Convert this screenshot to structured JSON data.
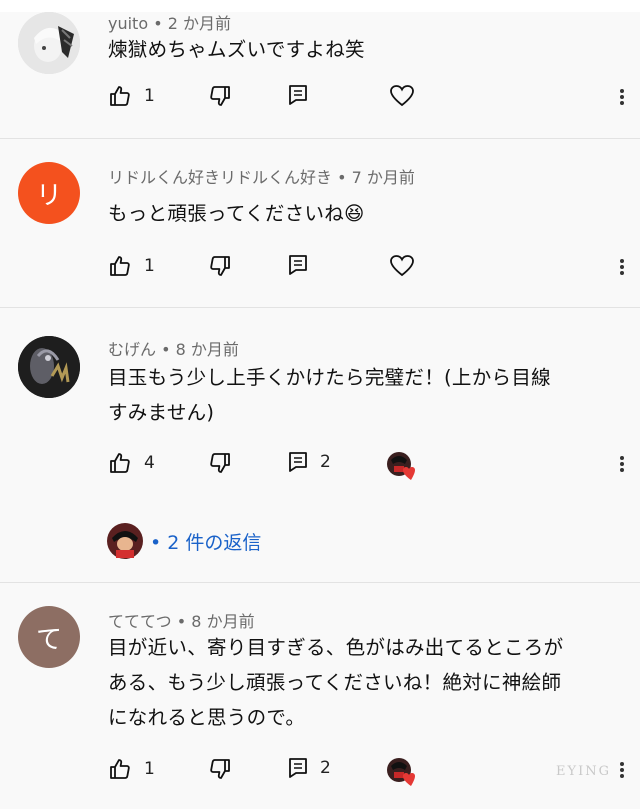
{
  "comments": [
    {
      "author": "yuito",
      "time": "2 か月前",
      "text": "煉獄めちゃムズいですよね笑",
      "likes": "1",
      "replies_count": "",
      "avatar_letter": "",
      "avatar_color": "#d8d8d8"
    },
    {
      "author": "リドルくん好きリドルくん好き",
      "time": "7 か月前",
      "text": "もっと頑張ってくださいね😆",
      "likes": "1",
      "replies_count": "",
      "avatar_letter": "リ",
      "avatar_color": "#f4511e"
    },
    {
      "author": "むげん",
      "time": "8 か月前",
      "text_lines": [
        "目玉もう少し上手くかけたら完璧だ！(上から目線",
        "すみません)"
      ],
      "likes": "4",
      "replies_count": "2",
      "avatar_letter": "",
      "avatar_color": "#2a2a2a"
    },
    {
      "author": "てててつ",
      "time": "8 か月前",
      "text_lines": [
        "目が近い、寄り目すぎる、色がはみ出てるところが",
        "ある、もう少し頑張ってくださいね！絶対に神絵師",
        "になれると思うので。"
      ],
      "likes": "1",
      "replies_count": "2",
      "avatar_letter": "て",
      "avatar_color": "#8d6e63"
    }
  ],
  "reply_link": "• 2 件の返信",
  "meta_separator": " • ",
  "watermark": "EYING",
  "colors": {
    "link": "#1a62c9",
    "heart": "#e53935"
  },
  "icons": [
    "thumbs-up-icon",
    "thumbs-down-icon",
    "reply-icon",
    "heart-icon",
    "more-vert-icon"
  ]
}
